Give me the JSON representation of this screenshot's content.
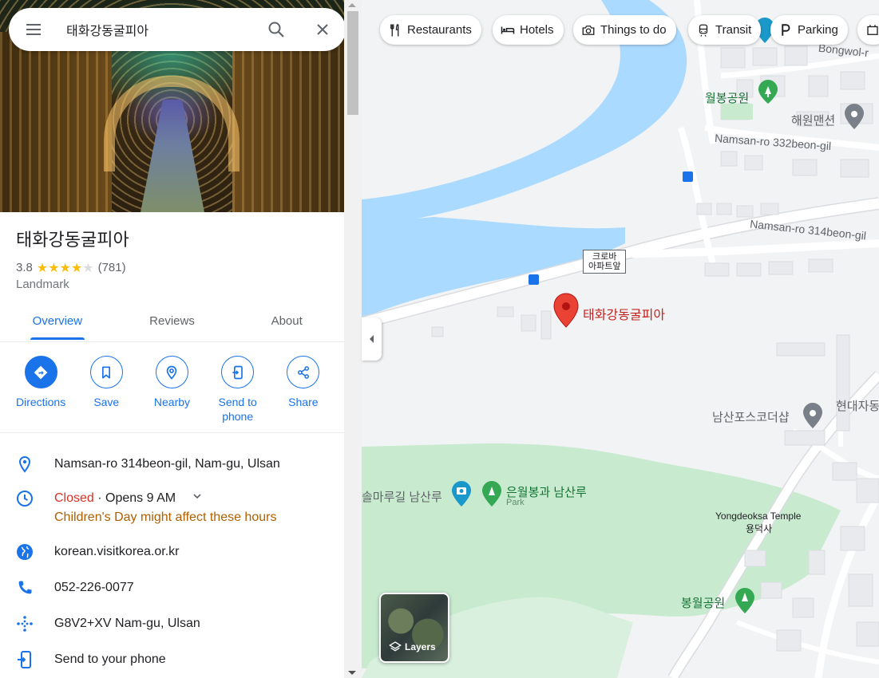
{
  "search": {
    "value": "태화강동굴피아"
  },
  "place": {
    "title": "태화강동굴피아",
    "rating": "3.8",
    "stars": "★★★★",
    "stars_empty": "★",
    "review_count": "(781)",
    "category": "Landmark"
  },
  "tabs": [
    {
      "label": "Overview"
    },
    {
      "label": "Reviews"
    },
    {
      "label": "About"
    }
  ],
  "actions": [
    {
      "label": "Directions"
    },
    {
      "label": "Save"
    },
    {
      "label": "Nearby"
    },
    {
      "label": "Send to phone"
    },
    {
      "label": "Share"
    }
  ],
  "info": {
    "address": "Namsan-ro 314beon-gil, Nam-gu, Ulsan",
    "hours_status": "Closed",
    "hours_sep": " · ",
    "hours_open": "Opens 9 AM",
    "hours_warning": "Children's Day might affect these hours",
    "website": "korean.visitkorea.or.kr",
    "phone": "052-226-0077",
    "plus_code": "G8V2+XV Nam-gu, Ulsan",
    "send": "Send to your phone"
  },
  "chips": [
    {
      "label": "Restaurants",
      "icon": "fork-knife-icon"
    },
    {
      "label": "Hotels",
      "icon": "bed-icon"
    },
    {
      "label": "Things to do",
      "icon": "camera-icon"
    },
    {
      "label": "Transit",
      "icon": "train-icon"
    },
    {
      "label": "Parking",
      "icon": "parking-icon"
    }
  ],
  "map": {
    "pin_label": "태화강동굴피아",
    "bus_stop_line1": "크로바",
    "bus_stop_line2": "아파트앞",
    "labels": {
      "bongwol": "Bongwol-r",
      "wolbong_park": "월봉공원",
      "haewon": "해원맨션",
      "namsan332": "Namsan-ro 332beon-gil",
      "namsan314": "Namsan-ro 314beon-gil",
      "namsan_posco": "남산포스코더샵",
      "hyundai": "현대자동",
      "solmaru": "솔마루길 남산루",
      "eunwol": "은월봉과 남산루",
      "park": "Park",
      "yongdeoksa_en": "Yongdeoksa Temple",
      "yongdeoksa_ko": "용덕사",
      "bongwol_park": "봉월공원"
    },
    "layers_label": "Layers"
  },
  "colors": {
    "accent": "#1a73e8",
    "water": "#aadaff",
    "park": "#c8ebd0",
    "road": "#ffffff",
    "closed": "#d93025",
    "warning": "#b06000",
    "pin": "#ea4335"
  }
}
